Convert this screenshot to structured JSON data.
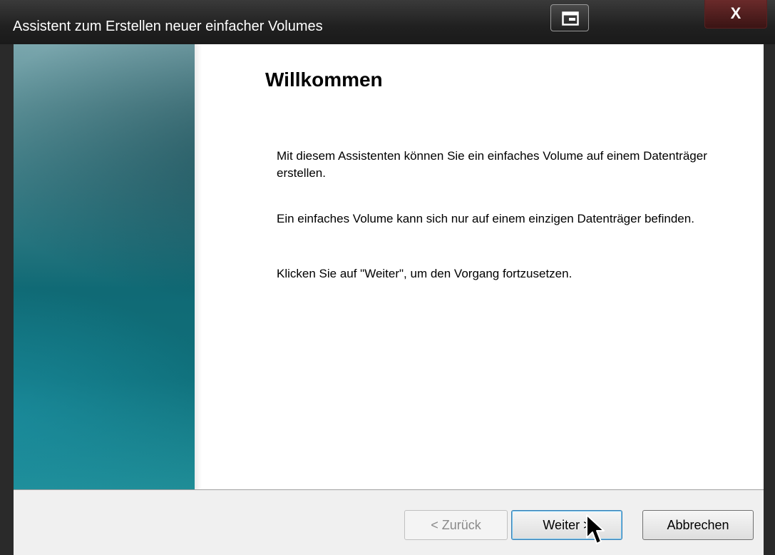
{
  "window": {
    "title": "Assistent zum Erstellen neuer einfacher Volumes",
    "close_label": "X"
  },
  "main": {
    "heading": "Willkommen",
    "paragraphs": [
      "Mit diesem Assistenten können Sie ein einfaches Volume auf einem Datenträger erstellen.",
      "Ein einfaches Volume kann sich nur auf einem einzigen Datenträger befinden.",
      "Klicken Sie auf \"Weiter\", um den Vorgang fortzusetzen."
    ]
  },
  "buttons": {
    "back_label": "< Zurück",
    "next_label": "Weiter >",
    "cancel_label": "Abbrechen"
  },
  "colors": {
    "accent_teal": "#106a75",
    "default_button_border": "#3c7fb1"
  },
  "icons": {
    "restore": "restore-window-icon",
    "close": "close-icon",
    "cursor": "mouse-pointer-icon"
  }
}
